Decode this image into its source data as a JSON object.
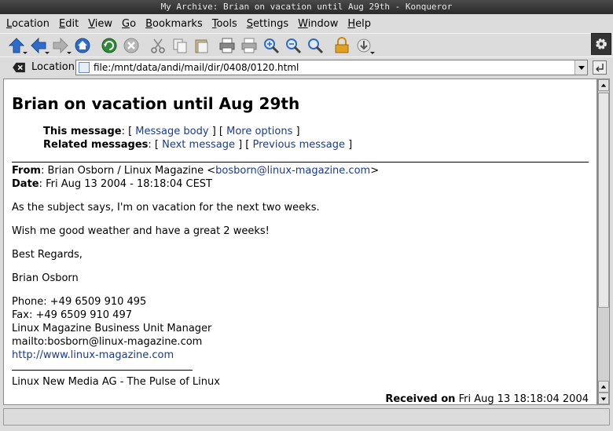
{
  "window": {
    "title": "My Archive: Brian on vacation until Aug 29th - Konqueror"
  },
  "menu": [
    {
      "label": "Location",
      "key": "L"
    },
    {
      "label": "Edit",
      "key": "E"
    },
    {
      "label": "View",
      "key": "V"
    },
    {
      "label": "Go",
      "key": "G"
    },
    {
      "label": "Bookmarks",
      "key": "B"
    },
    {
      "label": "Tools",
      "key": "T"
    },
    {
      "label": "Settings",
      "key": "S"
    },
    {
      "label": "Window",
      "key": "W"
    },
    {
      "label": "Help",
      "key": "H"
    }
  ],
  "toolbar": {
    "icons": [
      "up-arrow-icon",
      "back-arrow-icon",
      "forward-arrow-icon",
      "home-icon",
      "reload-icon",
      "stop-icon",
      "cut-icon",
      "copy-icon",
      "paste-icon",
      "print-icon",
      "print-frame-icon",
      "zoom-in-icon",
      "zoom-out-icon",
      "find-icon",
      "security-lock-icon",
      "download-icon"
    ],
    "colors": {
      "arrow": "#2f6bc8",
      "reload": "#2f8a3a",
      "stop": "#a8a8a8",
      "lock": "#e0a020"
    }
  },
  "location": {
    "label": "Location:",
    "url": "file:/mnt/data/andi/mail/dir/0408/0120.html"
  },
  "message": {
    "title": "Brian on vacation until Aug 29th",
    "this_message_label": "This message",
    "message_body_link": "Message body",
    "more_options_link": "More options",
    "related_label": "Related messages",
    "next_link": "Next message",
    "previous_link": "Previous message",
    "from_label": "From",
    "from_name": "Brian Osborn / Linux Magazine",
    "from_email": "bosborn@linux-magazine.com",
    "date_label": "Date",
    "date_value": "Fri Aug 13 2004 - 18:18:04 CEST",
    "body": [
      "As the subject says, I'm on vacation for the next two weeks.",
      "Wish me good weather and have a great 2 weeks!",
      "Best Regards,",
      "Brian Osborn"
    ],
    "contact": {
      "phone": "Phone: +49 6509 910 495",
      "fax": "Fax: +49 6509 910 497",
      "role": "Linux Magazine Business Unit Manager",
      "mailto": "mailto:bosborn@linux-magazine.com",
      "website": "http://www.linux-magazine.com"
    },
    "footer_tagline": "Linux New Media AG - The Pulse of Linux",
    "received_label": "Received on",
    "received_value": "Fri Aug 13 18:18:04 2004"
  }
}
